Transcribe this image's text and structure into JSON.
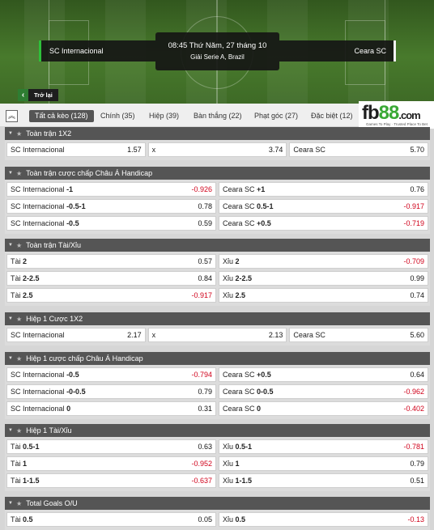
{
  "match": {
    "time": "08:45 Thứ Năm, 27 tháng 10",
    "league": "Giải Serie A, Brazil",
    "home_team": "SC Internacional",
    "away_team": "Ceara SC",
    "back_label": "Trở lại"
  },
  "tabs": [
    {
      "label": "Tất cả kèo (128)"
    },
    {
      "label": "Chính (35)"
    },
    {
      "label": "Hiệp (39)"
    },
    {
      "label": "Bàn thắng (22)"
    },
    {
      "label": "Phạt góc (27)"
    },
    {
      "label": "Đặc biệt (12)"
    }
  ],
  "brand": {
    "logo_main": "fb",
    "logo_accent": "88",
    "logo_suffix": ".com",
    "tagline": "Games To Play · Trusted Place To Bet"
  },
  "colors": {
    "negative_odd": "#d0021b",
    "section_header": "#555555",
    "accent_green": "#2ec03a"
  },
  "sections": [
    {
      "title": "Toàn trận 1X2",
      "rows": [
        [
          {
            "name": "SC Internacional",
            "line": "",
            "odd": "1.57"
          },
          {
            "name": "x",
            "line": "",
            "odd": "3.74"
          },
          {
            "name": "Ceara SC",
            "line": "",
            "odd": "5.70"
          }
        ]
      ]
    },
    {
      "title": "Toàn trận cược chấp Châu Á Handicap",
      "rows": [
        [
          {
            "name": "SC Internacional",
            "line": "-1",
            "odd": "-0.926"
          },
          {
            "name": "Ceara SC",
            "line": "+1",
            "odd": "0.76"
          }
        ],
        [
          {
            "name": "SC Internacional",
            "line": "-0.5-1",
            "odd": "0.78"
          },
          {
            "name": "Ceara SC",
            "line": "0.5-1",
            "odd": "-0.917"
          }
        ],
        [
          {
            "name": "SC Internacional",
            "line": "-0.5",
            "odd": "0.59"
          },
          {
            "name": "Ceara SC",
            "line": "+0.5",
            "odd": "-0.719"
          }
        ]
      ]
    },
    {
      "title": "Toàn trận Tài/Xỉu",
      "rows": [
        [
          {
            "name": "Tài",
            "line": "2",
            "odd": "0.57"
          },
          {
            "name": "Xỉu",
            "line": "2",
            "odd": "-0.709"
          }
        ],
        [
          {
            "name": "Tài",
            "line": "2-2.5",
            "odd": "0.84"
          },
          {
            "name": "Xỉu",
            "line": "2-2.5",
            "odd": "0.99"
          }
        ],
        [
          {
            "name": "Tài",
            "line": "2.5",
            "odd": "-0.917"
          },
          {
            "name": "Xỉu",
            "line": "2.5",
            "odd": "0.74"
          }
        ]
      ]
    },
    {
      "title": "Hiệp 1 Cược 1X2",
      "rows": [
        [
          {
            "name": "SC Internacional",
            "line": "",
            "odd": "2.17"
          },
          {
            "name": "x",
            "line": "",
            "odd": "2.13"
          },
          {
            "name": "Ceara SC",
            "line": "",
            "odd": "5.60"
          }
        ]
      ]
    },
    {
      "title": "Hiệp 1 cược chấp Châu Á Handicap",
      "rows": [
        [
          {
            "name": "SC Internacional",
            "line": "-0.5",
            "odd": "-0.794"
          },
          {
            "name": "Ceara SC",
            "line": "+0.5",
            "odd": "0.64"
          }
        ],
        [
          {
            "name": "SC Internacional",
            "line": "-0-0.5",
            "odd": "0.79"
          },
          {
            "name": "Ceara SC",
            "line": "0-0.5",
            "odd": "-0.962"
          }
        ],
        [
          {
            "name": "SC Internacional",
            "line": "0",
            "odd": "0.31"
          },
          {
            "name": "Ceara SC",
            "line": "0",
            "odd": "-0.402"
          }
        ]
      ]
    },
    {
      "title": "Hiệp 1 Tài/Xỉu",
      "rows": [
        [
          {
            "name": "Tài",
            "line": "0.5-1",
            "odd": "0.63"
          },
          {
            "name": "Xỉu",
            "line": "0.5-1",
            "odd": "-0.781"
          }
        ],
        [
          {
            "name": "Tài",
            "line": "1",
            "odd": "-0.952"
          },
          {
            "name": "Xỉu",
            "line": "1",
            "odd": "0.79"
          }
        ],
        [
          {
            "name": "Tài",
            "line": "1-1.5",
            "odd": "-0.637"
          },
          {
            "name": "Xỉu",
            "line": "1-1.5",
            "odd": "0.51"
          }
        ]
      ]
    },
    {
      "title": "Total Goals O/U",
      "rows": [
        [
          {
            "name": "Tài",
            "line": "0.5",
            "odd": "0.05"
          },
          {
            "name": "Xỉu",
            "line": "0.5",
            "odd": "-0.13"
          }
        ]
      ]
    }
  ]
}
